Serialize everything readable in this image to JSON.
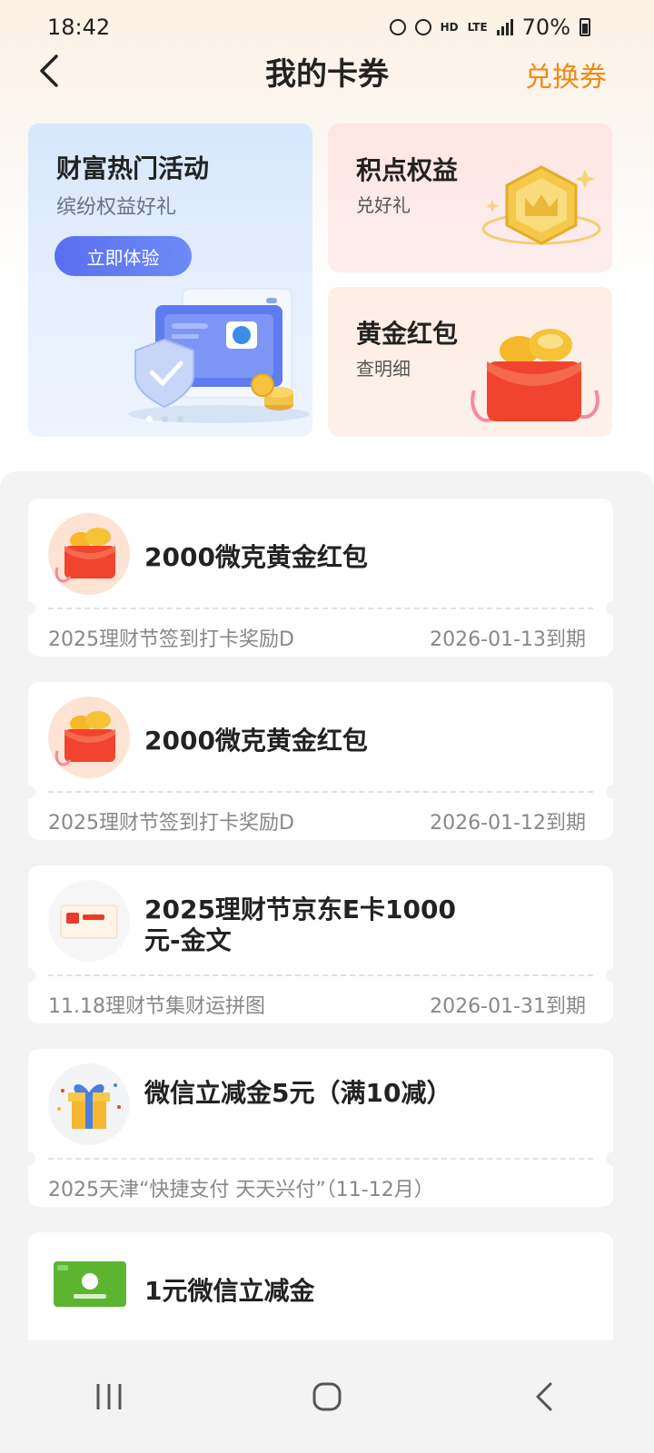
{
  "status_bar": {
    "time": "18:42",
    "network": "HD",
    "lte": "LTE",
    "battery": "70%"
  },
  "header": {
    "title": "我的卡券",
    "action_label": "兑换券"
  },
  "promos": {
    "left": {
      "title": "财富热门活动",
      "subtitle": "缤纷权益好礼",
      "button_label": "立即体验"
    },
    "right_top": {
      "title": "积点权益",
      "subtitle": "兑好礼"
    },
    "right_bottom": {
      "title": "黄金红包",
      "subtitle": "查明细"
    }
  },
  "coupons": [
    {
      "name": "2000微克黄金红包",
      "source": "2025理财节签到打卡奖励D",
      "expire": "2026-01-13到期",
      "icon": "red-envelope-icon"
    },
    {
      "name": "2000微克黄金红包",
      "source": "2025理财节签到打卡奖励D",
      "expire": "2026-01-12到期",
      "icon": "red-envelope-icon"
    },
    {
      "name": "2025理财节京东E卡1000元-金文",
      "source": "11.18理财节集财运拼图",
      "expire": "2026-01-31到期",
      "icon": "jd-card-icon"
    },
    {
      "name": "微信立减金5元（满10减）",
      "source": "2025天津“快捷支付 天天兴付”（11-12月）",
      "expire": "",
      "icon": "gift-box-icon"
    },
    {
      "name": "1元微信立减金",
      "icon": "wechat-card-icon"
    }
  ],
  "colors": {
    "accent": "#f08a12",
    "button_blue": "#5a6ef0",
    "red": "#f0442f",
    "gold": "#f5c12e"
  }
}
